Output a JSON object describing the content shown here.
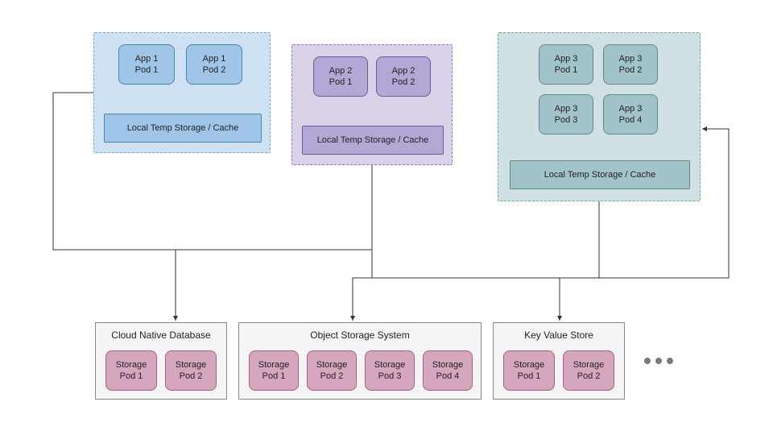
{
  "chart_data": {
    "type": "diagram",
    "title": "",
    "app_clusters": [
      {
        "id": "app1",
        "color": "blue",
        "pods": [
          "App 1 Pod 1",
          "App 1 Pod 2"
        ],
        "cache": "Local Temp Storage / Cache",
        "connects_to": [
          "cloud_native_database"
        ]
      },
      {
        "id": "app2",
        "color": "purple",
        "pods": [
          "App 2 Pod 1",
          "App 2 Pod 2"
        ],
        "cache": "Local Temp Storage / Cache",
        "connects_to": [
          "cloud_native_database",
          "object_storage_system"
        ]
      },
      {
        "id": "app3",
        "color": "teal",
        "pods": [
          "App 3 Pod 1",
          "App 3 Pod 2",
          "App 3 Pod 3",
          "App 3 Pod 4"
        ],
        "cache": "Local Temp Storage / Cache",
        "connects_to": [
          "object_storage_system",
          "key_value_store"
        ]
      }
    ],
    "storage_systems": [
      {
        "id": "cloud_native_database",
        "title": "Cloud Native Database",
        "pods": [
          "Storage Pod 1",
          "Storage Pod 2"
        ]
      },
      {
        "id": "object_storage_system",
        "title": "Object Storage System",
        "pods": [
          "Storage Pod 1",
          "Storage Pod 2",
          "Storage Pod 3",
          "Storage Pod 4"
        ]
      },
      {
        "id": "key_value_store",
        "title": "Key Value Store",
        "pods": [
          "Storage Pod 1",
          "Storage Pod 2"
        ]
      }
    ],
    "ellipsis": true
  },
  "app1": {
    "pod1": "App 1\nPod 1",
    "pod2": "App 1\nPod 2",
    "cache": "Local Temp Storage / Cache"
  },
  "app2": {
    "pod1": "App 2\nPod 1",
    "pod2": "App 2\nPod 2",
    "cache": "Local Temp Storage / Cache"
  },
  "app3": {
    "pod1": "App 3\nPod 1",
    "pod2": "App 3\nPod 2",
    "pod3": "App 3\nPod 3",
    "pod4": "App 3\nPod 4",
    "cache": "Local Temp Storage / Cache"
  },
  "storage1": {
    "title": "Cloud Native Database",
    "p1": "Storage\nPod 1",
    "p2": "Storage\nPod 2"
  },
  "storage2": {
    "title": "Object Storage System",
    "p1": "Storage\nPod 1",
    "p2": "Storage\nPod 2",
    "p3": "Storage\nPod 3",
    "p4": "Storage\nPod 4"
  },
  "storage3": {
    "title": "Key Value Store",
    "p1": "Storage\nPod 1",
    "p2": "Storage\nPod 2"
  }
}
